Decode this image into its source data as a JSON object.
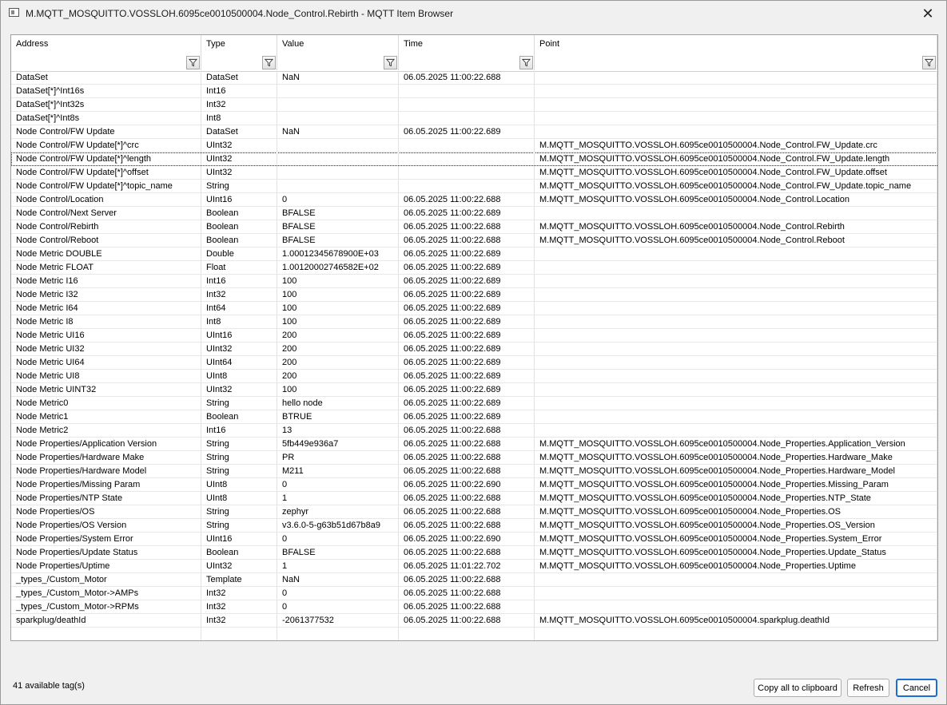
{
  "window": {
    "title": "M.MQTT_MOSQUITTO.VOSSLOH.6095ce0010500004.Node_Control.Rebirth - MQTT Item Browser",
    "close": "✕"
  },
  "columns": [
    "Address",
    "Type",
    "Value",
    "Time",
    "Point"
  ],
  "rows": [
    [
      "DataSet",
      "DataSet",
      "NaN",
      "06.05.2025 11:00:22.688",
      ""
    ],
    [
      "DataSet[*]^Int16s",
      "Int16",
      "",
      "",
      ""
    ],
    [
      "DataSet[*]^Int32s",
      "Int32",
      "",
      "",
      ""
    ],
    [
      "DataSet[*]^Int8s",
      "Int8",
      "",
      "",
      ""
    ],
    [
      "Node Control/FW Update",
      "DataSet",
      "NaN",
      "06.05.2025 11:00:22.689",
      ""
    ],
    [
      "Node Control/FW Update[*]^crc",
      "UInt32",
      "",
      "",
      "M.MQTT_MOSQUITTO.VOSSLOH.6095ce0010500004.Node_Control.FW_Update.crc"
    ],
    [
      "Node Control/FW Update[*]^length",
      "UInt32",
      "",
      "",
      "M.MQTT_MOSQUITTO.VOSSLOH.6095ce0010500004.Node_Control.FW_Update.length"
    ],
    [
      "Node Control/FW Update[*]^offset",
      "UInt32",
      "",
      "",
      "M.MQTT_MOSQUITTO.VOSSLOH.6095ce0010500004.Node_Control.FW_Update.offset"
    ],
    [
      "Node Control/FW Update[*]^topic_name",
      "String",
      "",
      "",
      "M.MQTT_MOSQUITTO.VOSSLOH.6095ce0010500004.Node_Control.FW_Update.topic_name"
    ],
    [
      "Node Control/Location",
      "UInt16",
      " 0",
      "06.05.2025 11:00:22.688",
      "M.MQTT_MOSQUITTO.VOSSLOH.6095ce0010500004.Node_Control.Location"
    ],
    [
      "Node Control/Next Server",
      "Boolean",
      "BFALSE",
      "06.05.2025 11:00:22.689",
      ""
    ],
    [
      "Node Control/Rebirth",
      "Boolean",
      "BFALSE",
      "06.05.2025 11:00:22.688",
      "M.MQTT_MOSQUITTO.VOSSLOH.6095ce0010500004.Node_Control.Rebirth"
    ],
    [
      "Node Control/Reboot",
      "Boolean",
      "BFALSE",
      "06.05.2025 11:00:22.688",
      "M.MQTT_MOSQUITTO.VOSSLOH.6095ce0010500004.Node_Control.Reboot"
    ],
    [
      "Node Metric DOUBLE",
      "Double",
      " 1.00012345678900E+03",
      "06.05.2025 11:00:22.689",
      ""
    ],
    [
      "Node Metric FLOAT",
      "Float",
      " 1.00120002746582E+02",
      "06.05.2025 11:00:22.689",
      ""
    ],
    [
      "Node Metric I16",
      "Int16",
      " 100",
      "06.05.2025 11:00:22.689",
      ""
    ],
    [
      "Node Metric I32",
      "Int32",
      " 100",
      "06.05.2025 11:00:22.689",
      ""
    ],
    [
      "Node Metric I64",
      "Int64",
      " 100",
      "06.05.2025 11:00:22.689",
      ""
    ],
    [
      "Node Metric I8",
      "Int8",
      " 100",
      "06.05.2025 11:00:22.689",
      ""
    ],
    [
      "Node Metric UI16",
      "UInt16",
      " 200",
      "06.05.2025 11:00:22.689",
      ""
    ],
    [
      "Node Metric UI32",
      "UInt32",
      " 200",
      "06.05.2025 11:00:22.689",
      ""
    ],
    [
      "Node Metric UI64",
      "UInt64",
      " 200",
      "06.05.2025 11:00:22.689",
      ""
    ],
    [
      "Node Metric UI8",
      "UInt8",
      " 200",
      "06.05.2025 11:00:22.689",
      ""
    ],
    [
      "Node Metric UINT32",
      "UInt32",
      " 100",
      "06.05.2025 11:00:22.689",
      ""
    ],
    [
      "Node Metric0",
      "String",
      "hello node",
      "06.05.2025 11:00:22.689",
      ""
    ],
    [
      "Node Metric1",
      "Boolean",
      "BTRUE",
      "06.05.2025 11:00:22.689",
      ""
    ],
    [
      "Node Metric2",
      "Int16",
      " 13",
      "06.05.2025 11:00:22.688",
      ""
    ],
    [
      "Node Properties/Application Version",
      "String",
      "5fb449e936a7",
      "06.05.2025 11:00:22.688",
      "M.MQTT_MOSQUITTO.VOSSLOH.6095ce0010500004.Node_Properties.Application_Version"
    ],
    [
      "Node Properties/Hardware Make",
      "String",
      "PR",
      "06.05.2025 11:00:22.688",
      "M.MQTT_MOSQUITTO.VOSSLOH.6095ce0010500004.Node_Properties.Hardware_Make"
    ],
    [
      "Node Properties/Hardware Model",
      "String",
      "M211",
      "06.05.2025 11:00:22.688",
      "M.MQTT_MOSQUITTO.VOSSLOH.6095ce0010500004.Node_Properties.Hardware_Model"
    ],
    [
      "Node Properties/Missing Param",
      "UInt8",
      " 0",
      "06.05.2025 11:00:22.690",
      "M.MQTT_MOSQUITTO.VOSSLOH.6095ce0010500004.Node_Properties.Missing_Param"
    ],
    [
      "Node Properties/NTP State",
      "UInt8",
      " 1",
      "06.05.2025 11:00:22.688",
      "M.MQTT_MOSQUITTO.VOSSLOH.6095ce0010500004.Node_Properties.NTP_State"
    ],
    [
      "Node Properties/OS",
      "String",
      "zephyr",
      "06.05.2025 11:00:22.688",
      "M.MQTT_MOSQUITTO.VOSSLOH.6095ce0010500004.Node_Properties.OS"
    ],
    [
      "Node Properties/OS Version",
      "String",
      "v3.6.0-5-g63b51d67b8a9",
      "06.05.2025 11:00:22.688",
      "M.MQTT_MOSQUITTO.VOSSLOH.6095ce0010500004.Node_Properties.OS_Version"
    ],
    [
      "Node Properties/System Error",
      "UInt16",
      " 0",
      "06.05.2025 11:00:22.690",
      "M.MQTT_MOSQUITTO.VOSSLOH.6095ce0010500004.Node_Properties.System_Error"
    ],
    [
      "Node Properties/Update Status",
      "Boolean",
      "BFALSE",
      "06.05.2025 11:00:22.688",
      "M.MQTT_MOSQUITTO.VOSSLOH.6095ce0010500004.Node_Properties.Update_Status"
    ],
    [
      "Node Properties/Uptime",
      "UInt32",
      " 1",
      "06.05.2025 11:01:22.702",
      "M.MQTT_MOSQUITTO.VOSSLOH.6095ce0010500004.Node_Properties.Uptime"
    ],
    [
      "_types_/Custom_Motor",
      "Template",
      "NaN",
      "06.05.2025 11:00:22.688",
      ""
    ],
    [
      "_types_/Custom_Motor->AMPs",
      "Int32",
      " 0",
      "06.05.2025 11:00:22.688",
      ""
    ],
    [
      "_types_/Custom_Motor->RPMs",
      "Int32",
      " 0",
      "06.05.2025 11:00:22.688",
      ""
    ],
    [
      "sparkplug/deathId",
      "Int32",
      "-2061377532",
      "06.05.2025 11:00:22.688",
      "M.MQTT_MOSQUITTO.VOSSLOH.6095ce0010500004.sparkplug.deathId"
    ]
  ],
  "focused_row": 6,
  "footer": {
    "status": "41 available tag(s)",
    "copy_label": "Copy all to clipboard",
    "refresh_label": "Refresh",
    "cancel_label": "Cancel"
  }
}
